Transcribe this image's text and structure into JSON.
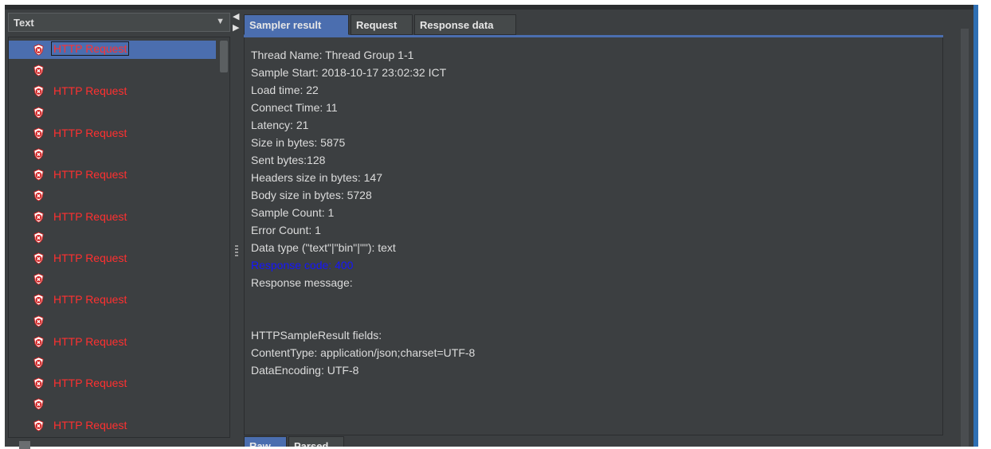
{
  "left_panel": {
    "renderer_select": "Text",
    "tree_items": [
      {
        "label": "HTTP Request",
        "selected": true
      },
      {
        "label": "",
        "selected": false
      },
      {
        "label": "HTTP Request",
        "selected": false
      },
      {
        "label": "",
        "selected": false
      },
      {
        "label": "HTTP Request",
        "selected": false
      },
      {
        "label": "",
        "selected": false
      },
      {
        "label": "HTTP Request",
        "selected": false
      },
      {
        "label": "",
        "selected": false
      },
      {
        "label": "HTTP Request",
        "selected": false
      },
      {
        "label": "",
        "selected": false
      },
      {
        "label": "HTTP Request",
        "selected": false
      },
      {
        "label": "",
        "selected": false
      },
      {
        "label": "HTTP Request",
        "selected": false
      },
      {
        "label": "",
        "selected": false
      },
      {
        "label": "HTTP Request",
        "selected": false
      },
      {
        "label": "",
        "selected": false
      },
      {
        "label": "HTTP Request",
        "selected": false
      },
      {
        "label": "",
        "selected": false
      },
      {
        "label": "HTTP Request",
        "selected": false
      }
    ],
    "bottom_option": ""
  },
  "tabs": [
    "Sampler result",
    "Request",
    "Response data"
  ],
  "sampler_result": [
    {
      "text": "Thread Name: Thread Group 1-1"
    },
    {
      "text": "Sample Start: 2018-10-17 23:02:32 ICT"
    },
    {
      "text": "Load time: 22"
    },
    {
      "text": "Connect Time: 11"
    },
    {
      "text": "Latency: 21"
    },
    {
      "text": "Size in bytes: 5875"
    },
    {
      "text": "Sent bytes:128"
    },
    {
      "text": "Headers size in bytes: 147"
    },
    {
      "text": "Body size in bytes: 5728"
    },
    {
      "text": "Sample Count: 1"
    },
    {
      "text": "Error Count: 1"
    },
    {
      "text": "Data type (\"text\"|\"bin\"|\"\"): text"
    },
    {
      "text": "Response code: 400",
      "highlight": true
    },
    {
      "text": "Response message:"
    },
    {
      "text": ""
    },
    {
      "text": ""
    },
    {
      "text": "HTTPSampleResult fields:"
    },
    {
      "text": "ContentType: application/json;charset=UTF-8"
    },
    {
      "text": "DataEncoding: UTF-8"
    }
  ],
  "bottom_tabs": [
    "Raw",
    "Parsed"
  ],
  "colors": {
    "error_text": "#ff3030",
    "highlight_text": "#1515ff",
    "selection": "#4b6eaf"
  },
  "icons": {
    "tree_item": "error-shield-icon",
    "dropdown": "chevron-down-icon"
  }
}
